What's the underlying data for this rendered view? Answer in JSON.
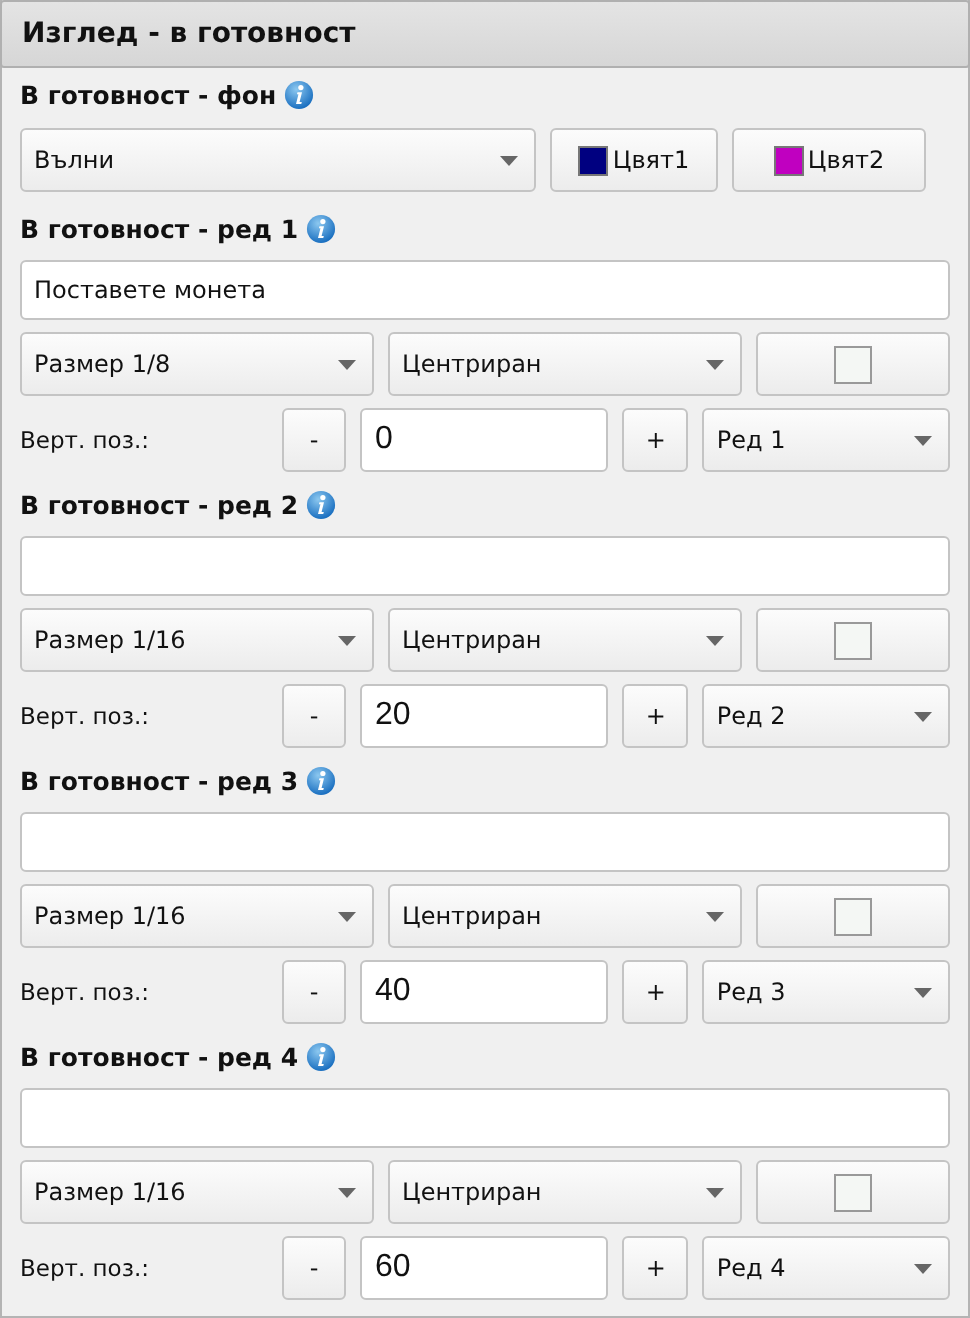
{
  "header": {
    "title": "Изглед - в готовност"
  },
  "background": {
    "label": "В готовност - фон",
    "style": "Вълни",
    "colors": [
      {
        "label": "Цвят1",
        "color": "#000080"
      },
      {
        "label": "Цвят2",
        "color": "#c000c0"
      }
    ]
  },
  "lines": [
    {
      "label": "В готовност - ред 1",
      "text": "Поставете монета",
      "size": "Размер 1/8",
      "align": "Центриран",
      "color": "#f4f7f4",
      "pos_label": "Верт. поз.:",
      "minus": "-",
      "value": "0",
      "plus": "+",
      "row": "Ред 1"
    },
    {
      "label": "В готовност - ред 2",
      "size": "Размер 1/16",
      "align": "Центриран",
      "color": "#f4f7f4",
      "pos_label": "Верт. поз.:",
      "minus": "-",
      "value": "20",
      "plus": "+",
      "row": "Ред 2"
    },
    {
      "label": "В готовност - ред 3",
      "size": "Размер 1/16",
      "align": "Центриран",
      "color": "#f4f7f4",
      "pos_label": "Верт. поз.:",
      "minus": "-",
      "value": "40",
      "plus": "+",
      "row": "Ред 3"
    },
    {
      "label": "В готовност - ред 4",
      "size": "Размер 1/16",
      "align": "Центриран",
      "color": "#f4f7f4",
      "pos_label": "Верт. поз.:",
      "minus": "-",
      "value": "60",
      "plus": "+",
      "row": "Ред 4"
    }
  ]
}
